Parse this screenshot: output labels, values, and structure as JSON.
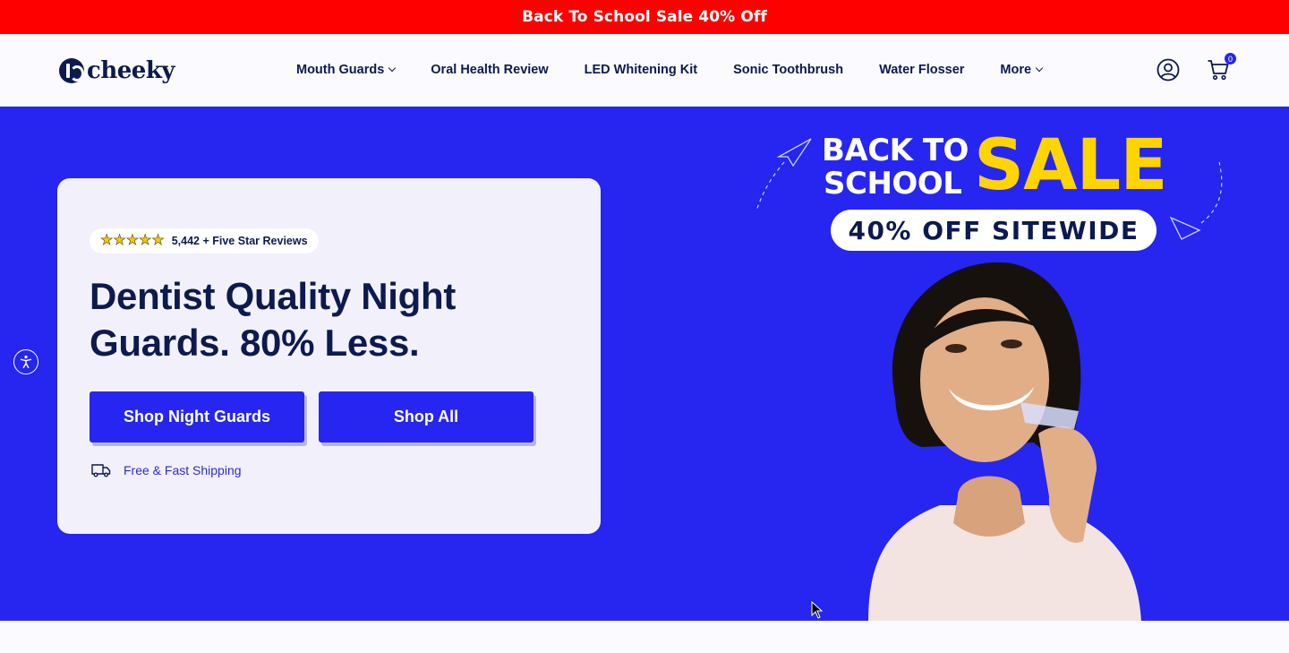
{
  "announcement": {
    "text": "Back To School Sale 40% Off",
    "bg_color": "#ff0000"
  },
  "header": {
    "logo_text": "cheeky",
    "nav": [
      {
        "label": "Mouth Guards",
        "has_dropdown": true
      },
      {
        "label": "Oral Health Review",
        "has_dropdown": false
      },
      {
        "label": "LED Whitening Kit",
        "has_dropdown": false
      },
      {
        "label": "Sonic Toothbrush",
        "has_dropdown": false
      },
      {
        "label": "Water Flosser",
        "has_dropdown": false
      },
      {
        "label": "More",
        "has_dropdown": true
      }
    ],
    "icons": {
      "account": "account-circle-icon",
      "cart": "cart-icon"
    },
    "cart_count": "0"
  },
  "hero": {
    "bg_color": "#2626f0",
    "reviews": {
      "rating_stars": 5,
      "text": "5,442 + Five Star Reviews"
    },
    "headline": "Dentist Quality Night Guards. 80% Less.",
    "buttons": {
      "primary": "Shop Night Guards",
      "secondary": "Shop All"
    },
    "shipping": {
      "icon": "truck-icon",
      "text": "Free & Fast Shipping"
    },
    "promo": {
      "line1": "BACK TO",
      "line2": "SCHOOL",
      "sale": "SALE",
      "pill": "40% OFF SITEWIDE",
      "sale_color": "#ffd400"
    }
  },
  "accessibility": {
    "icon": "accessibility-icon"
  }
}
